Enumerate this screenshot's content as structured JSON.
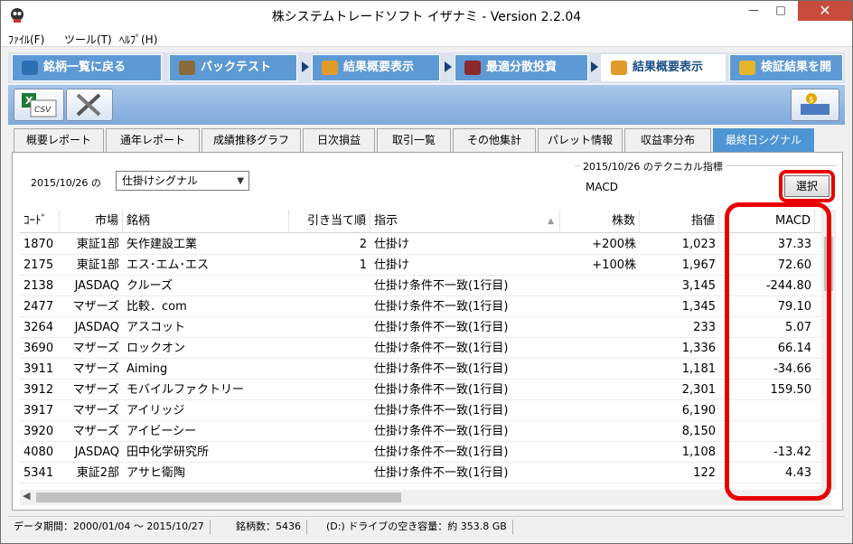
{
  "window": {
    "title": "株システムトレードソフト イザナミ - Version 2.2.04"
  },
  "menu": [
    "ﾌｧｲﾙ(F)",
    "ツール(T)",
    "ﾍﾙﾌﾟ(H)"
  ],
  "main_tabs": [
    "銘柄一覧に戻る",
    "バックテスト",
    "結果概要表示",
    "最適分散投資",
    "結果概要表示",
    "検証結果を開く"
  ],
  "sub_tabs": [
    "概要レポート",
    "通年レポート",
    "成績推移グラフ",
    "日次損益",
    "取引一覧",
    "その他集計",
    "パレット情報",
    "収益率分布",
    "最終日シグナル"
  ],
  "toolbar": {
    "csv_icon_text": "CSV"
  },
  "filter": {
    "date_label": "2015/10/26 の",
    "signal_select": "仕掛けシグナル"
  },
  "tech": {
    "title": "2015/10/26 のテクニカル指標",
    "value": "MACD",
    "select_button": "選択"
  },
  "table": {
    "columns": [
      "ｺｰﾄﾞ",
      "市場",
      "銘柄",
      "引き当て順",
      "指示",
      "株数",
      "指値",
      "MACD"
    ],
    "rows": [
      [
        "1870",
        "東証1部",
        "矢作建設工業",
        "2",
        "仕掛け",
        "+200株",
        "1,023",
        "37.33"
      ],
      [
        "2175",
        "東証1部",
        "エス･エム･エス",
        "1",
        "仕掛け",
        "+100株",
        "1,967",
        "72.60"
      ],
      [
        "2138",
        "JASDAQ",
        "クルーズ",
        "",
        "仕掛け条件不一致(1行目)",
        "",
        "3,145",
        "-244.80"
      ],
      [
        "2477",
        "マザーズ",
        "比較．com",
        "",
        "仕掛け条件不一致(1行目)",
        "",
        "1,345",
        "79.10"
      ],
      [
        "3264",
        "JASDAQ",
        "アスコット",
        "",
        "仕掛け条件不一致(1行目)",
        "",
        "233",
        "5.07"
      ],
      [
        "3690",
        "マザーズ",
        "ロックオン",
        "",
        "仕掛け条件不一致(1行目)",
        "",
        "1,336",
        "66.14"
      ],
      [
        "3911",
        "マザーズ",
        "Aiming",
        "",
        "仕掛け条件不一致(1行目)",
        "",
        "1,181",
        "-34.66"
      ],
      [
        "3912",
        "マザーズ",
        "モバイルファクトリー",
        "",
        "仕掛け条件不一致(1行目)",
        "",
        "2,301",
        "159.50"
      ],
      [
        "3917",
        "マザーズ",
        "アイリッジ",
        "",
        "仕掛け条件不一致(1行目)",
        "",
        "6,190",
        ""
      ],
      [
        "3920",
        "マザーズ",
        "アイビーシー",
        "",
        "仕掛け条件不一致(1行目)",
        "",
        "8,150",
        ""
      ],
      [
        "4080",
        "JASDAQ",
        "田中化学研究所",
        "",
        "仕掛け条件不一致(1行目)",
        "",
        "1,108",
        "-13.42"
      ],
      [
        "5341",
        "東証2部",
        "アサヒ衛陶",
        "",
        "仕掛け条件不一致(1行目)",
        "",
        "122",
        "4.43"
      ]
    ]
  },
  "status": {
    "period": "データ期間：2000/01/04 〜 2015/10/27",
    "count": "銘柄数：5436",
    "disk": "(D:) ドライブの空き容量：約 353.8 GB"
  }
}
